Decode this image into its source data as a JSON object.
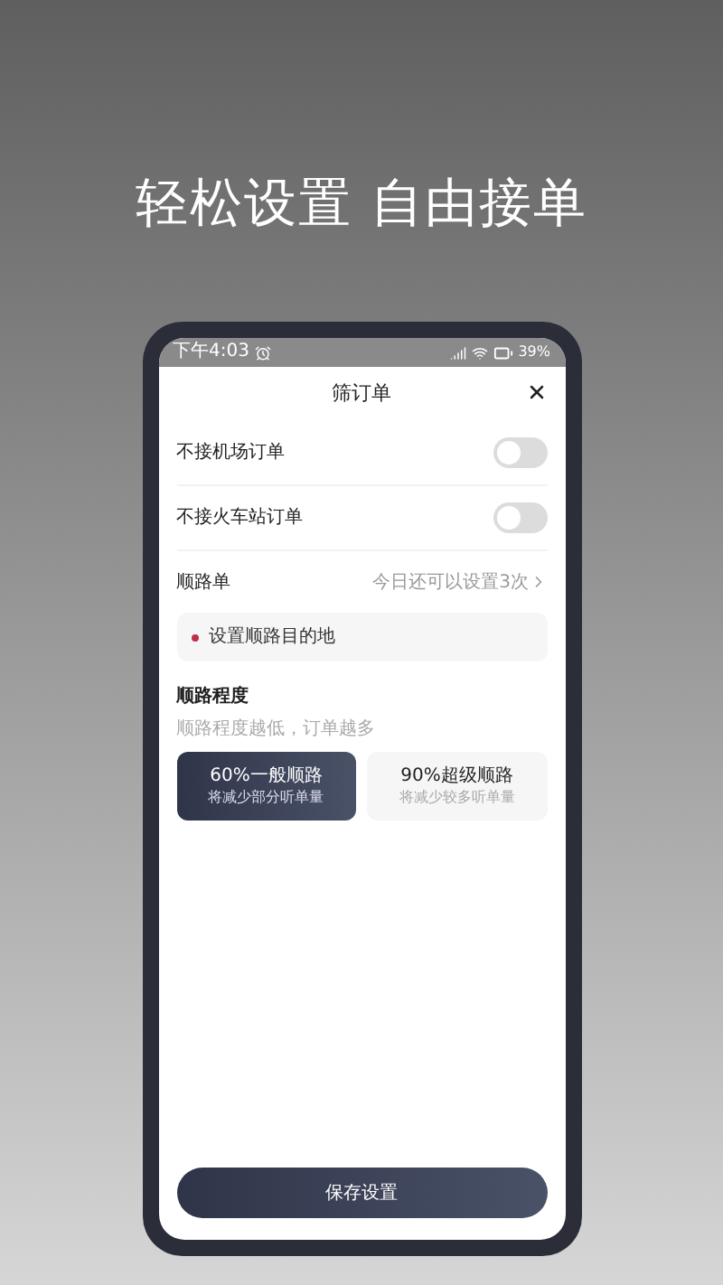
{
  "headline": "轻松设置 自由接单",
  "status_bar": {
    "time": "下午4:03",
    "battery": "39%"
  },
  "sheet": {
    "title": "筛订单",
    "toggles": [
      {
        "label": "不接机场订单",
        "on": false
      },
      {
        "label": "不接火车站订单",
        "on": false
      }
    ],
    "route_order": {
      "label": "顺路单",
      "hint": "今日还可以设置3次",
      "destination": "设置顺路目的地"
    },
    "route_degree": {
      "title": "顺路程度",
      "subtitle": "顺路程度越低，订单越多",
      "options": [
        {
          "title": "60%一般顺路",
          "desc": "将减少部分听单量",
          "selected": true
        },
        {
          "title": "90%超级顺路",
          "desc": "将减少较多听单量",
          "selected": false
        }
      ]
    },
    "save_button": "保存设置"
  }
}
